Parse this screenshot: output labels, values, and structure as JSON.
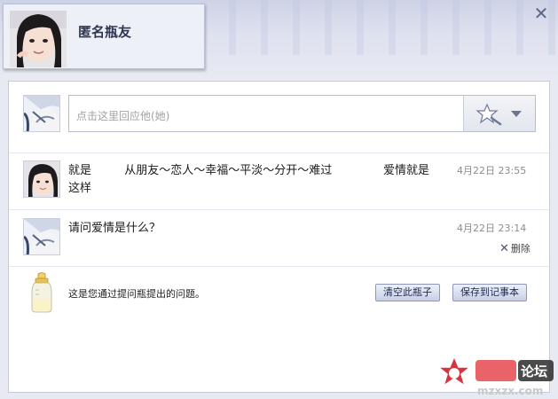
{
  "header": {
    "name": "匿名瓶友"
  },
  "reply": {
    "placeholder": "点击这里回应他(她)"
  },
  "messages": [
    {
      "text": "就是         从朋友～恋人～幸福～平淡～分开～难过              爱情就是\n这样",
      "time": "4月22日 23:55"
    },
    {
      "text": "请问爱情是什么？",
      "time": "4月22日 23:14",
      "delete_label": "删除"
    }
  ],
  "footer": {
    "hint": "这是您通过提问瓶提出的问题。",
    "clear_button": "清空此瓶子",
    "save_button": "保存到记事本"
  },
  "watermark": {
    "text": "论坛",
    "url_text": "mzxzx.com"
  },
  "colors": {
    "accent": "#2e3650",
    "panel_border": "#c5c9dc",
    "button_border": "#8d97bb"
  }
}
